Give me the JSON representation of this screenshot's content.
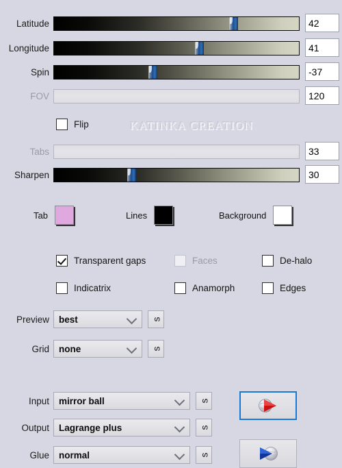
{
  "app": {
    "background_color": "#d7d7e3",
    "watermark": "KATINKA CREATION"
  },
  "sliders": [
    {
      "label": "Latitude",
      "value": "42",
      "percent": 72,
      "disabled": false
    },
    {
      "label": "Longitude",
      "value": "41",
      "percent": 58,
      "disabled": false
    },
    {
      "label": "Spin",
      "value": "-37",
      "percent": 39,
      "disabled": false
    },
    {
      "label": "FOV",
      "value": "120",
      "percent": 0,
      "disabled": true
    },
    {
      "label": "Tabs",
      "value": "33",
      "percent": 0,
      "disabled": true
    },
    {
      "label": "Sharpen",
      "value": "30",
      "percent": 31,
      "disabled": false
    }
  ],
  "flip": {
    "label": "Flip",
    "checked": false
  },
  "swatches": [
    {
      "label": "Tab",
      "color": "#dfa8de"
    },
    {
      "label": "Lines",
      "color": "#000000"
    },
    {
      "label": "Background",
      "color": "#ffffff"
    }
  ],
  "checkboxes": [
    {
      "label": "Transparent gaps",
      "checked": true,
      "disabled": false
    },
    {
      "label": "Faces",
      "checked": false,
      "disabled": true
    },
    {
      "label": "De-halo",
      "checked": false,
      "disabled": false
    },
    {
      "label": "Indicatrix",
      "checked": false,
      "disabled": false
    },
    {
      "label": "Anamorph",
      "checked": false,
      "disabled": false
    },
    {
      "label": "Edges",
      "checked": false,
      "disabled": false
    }
  ],
  "dropdowns": [
    {
      "label": "Preview",
      "value": "best",
      "side_button": "s"
    },
    {
      "label": "Grid",
      "value": "none",
      "side_button": "s"
    },
    {
      "label": "Input",
      "value": "mirror ball",
      "side_button": "s"
    },
    {
      "label": "Output",
      "value": "Lagrange plus",
      "side_button": "s"
    },
    {
      "label": "Glue",
      "value": "normal",
      "side_button": "s"
    }
  ],
  "icon_buttons": [
    {
      "icon": "sphere-play-red-icon",
      "focused": true
    },
    {
      "icon": "sphere-play-blue-icon",
      "focused": false
    }
  ]
}
